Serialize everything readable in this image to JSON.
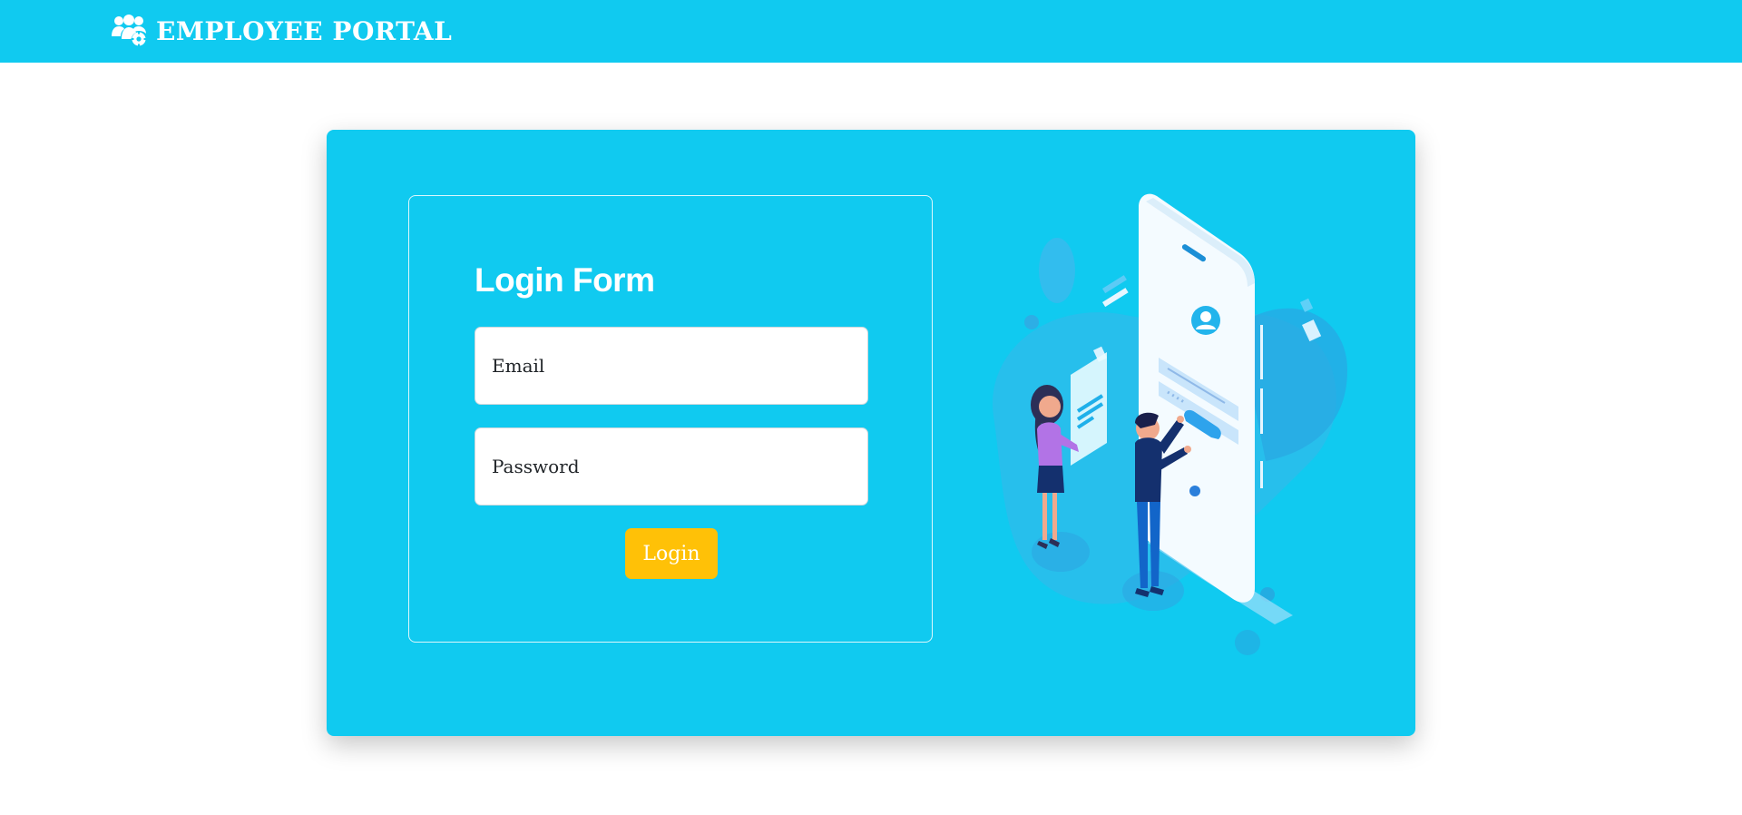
{
  "navbar": {
    "brand_icon": "users-cog-icon",
    "brand_text": "EMPLOYEE PORTAL"
  },
  "login": {
    "title": "Login Form",
    "email_placeholder": "Email",
    "email_value": "",
    "password_placeholder": "Password",
    "password_value": "",
    "submit_label": "Login"
  },
  "illustration": {
    "icon": "mobile-login-illustration"
  },
  "colors": {
    "primary": "#10caf0",
    "button": "#ffc107",
    "text_on_primary": "#ffffff",
    "page_background": "#ffffff"
  }
}
